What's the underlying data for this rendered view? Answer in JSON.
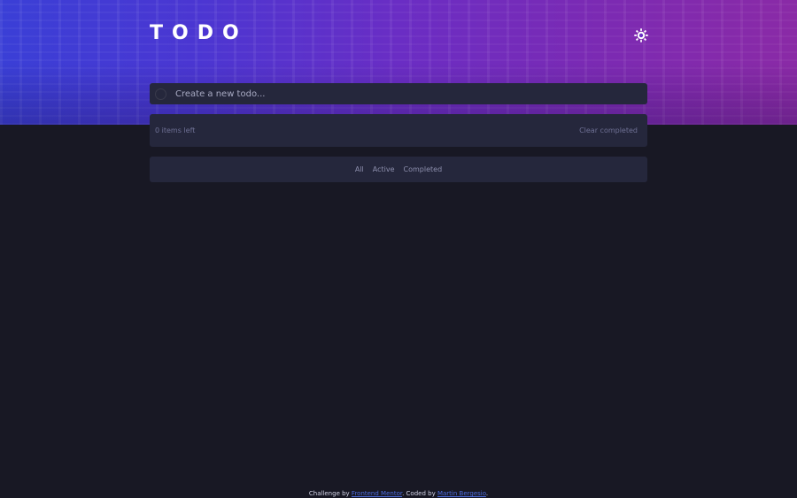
{
  "header": {
    "title": "TODO",
    "theme_icon": "sun-icon"
  },
  "new_todo": {
    "placeholder": "Create a new todo...",
    "value": ""
  },
  "list_footer": {
    "items_left": "0 items left",
    "clear_completed": "Clear completed"
  },
  "filters": {
    "all": "All",
    "active": "Active",
    "completed": "Completed"
  },
  "credits": {
    "challenge_by": "Challenge by",
    "frontend_mentor": "Frontend Mentor",
    "coded_by": ". Coded by",
    "author": "Martin Bergesio",
    "end": "."
  },
  "colors": {
    "background": "#181824",
    "panel": "#25273c",
    "link": "#4e6ee0",
    "gradient_start": "#3a3fd6",
    "gradient_end": "#8a2aa6"
  }
}
